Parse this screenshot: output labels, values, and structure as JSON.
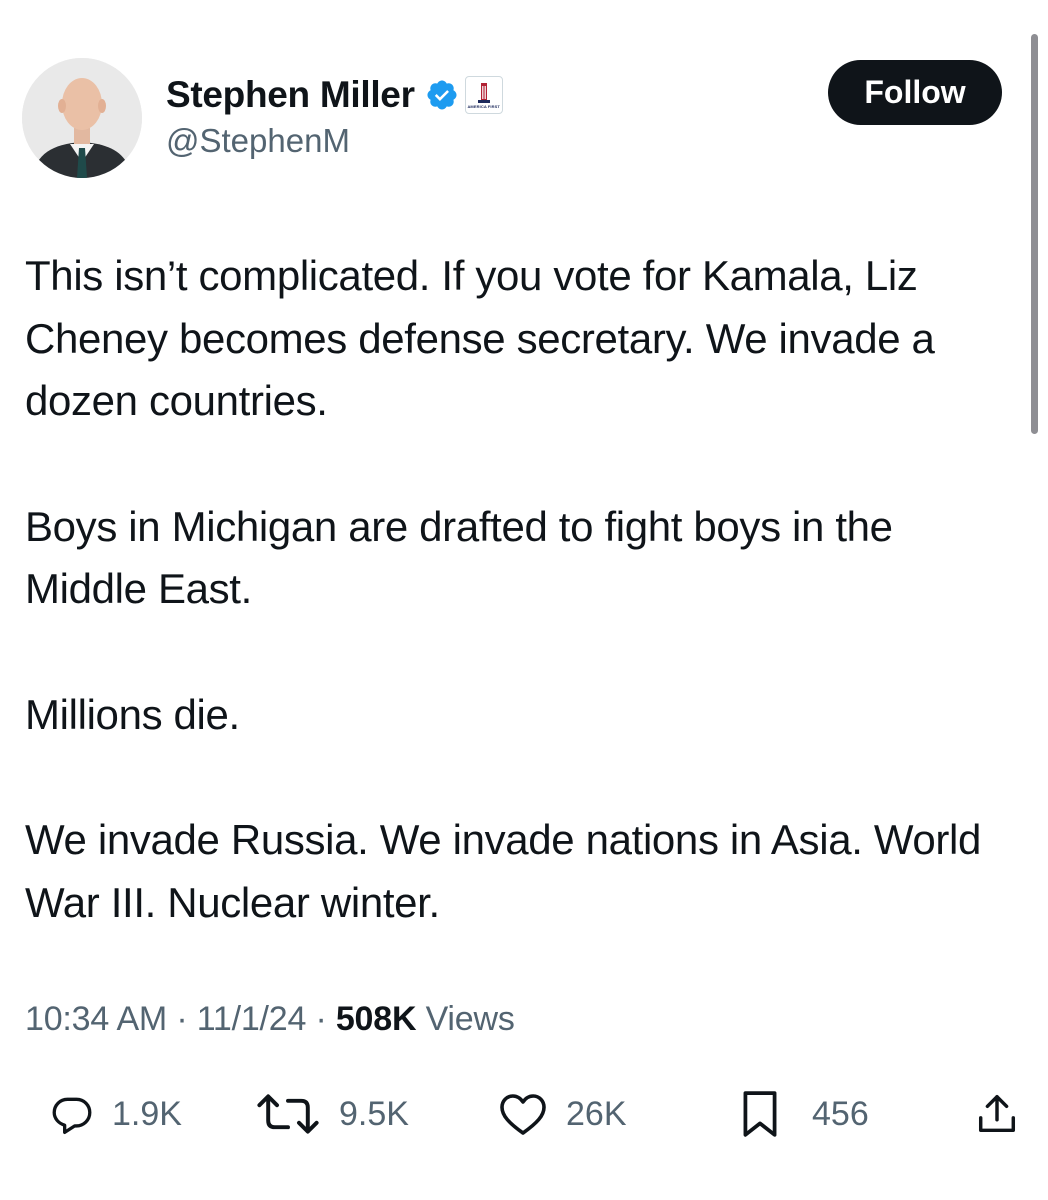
{
  "author": {
    "display_name": "Stephen Miller",
    "handle": "@StephenM",
    "verified": true,
    "affiliate_badge_text": "AMERICA FIRST"
  },
  "follow_button": {
    "label": "Follow"
  },
  "tweet": {
    "paragraphs": [
      "This isn’t complicated. If you vote for Kamala, Liz Cheney becomes defense secretary. We invade a dozen countries.",
      "Boys in Michigan are drafted to fight boys in the Middle East.",
      "Millions die.",
      "We invade Russia. We invade nations in Asia. World War III. Nuclear winter."
    ]
  },
  "meta": {
    "time": "10:34 AM",
    "separator": "·",
    "date": "11/1/24",
    "views_count": "508K",
    "views_label": "Views"
  },
  "actions": {
    "replies": "1.9K",
    "reposts": "9.5K",
    "likes": "26K",
    "bookmarks": "456"
  },
  "colors": {
    "text_primary": "#0f1419",
    "text_secondary": "#536471",
    "verified_blue": "#1d9bf0",
    "button_bg": "#0f1419",
    "button_text": "#ffffff"
  }
}
